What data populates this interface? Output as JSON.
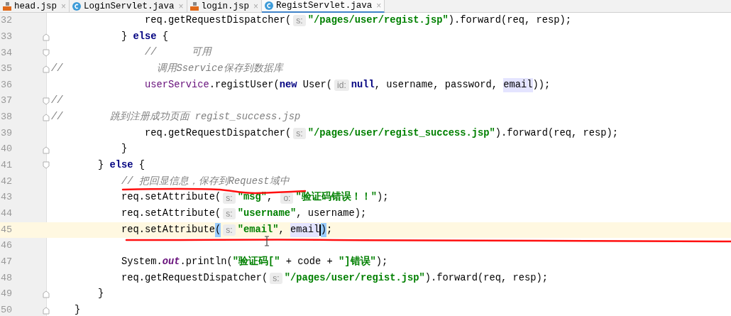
{
  "tabs": [
    {
      "label": "head.jsp",
      "kind": "jsp",
      "close": "×",
      "selected": false
    },
    {
      "label": "LoginServlet.java",
      "kind": "class",
      "close": "×",
      "selected": false
    },
    {
      "label": "login.jsp",
      "kind": "jsp",
      "close": "×",
      "selected": false
    },
    {
      "label": "RegistServlet.java",
      "kind": "class",
      "close": "×",
      "selected": true
    }
  ],
  "editor": {
    "lines": [
      {
        "number": "32",
        "current": false,
        "kind": "plain",
        "tokens": [
          {
            "kind": "plain",
            "text": "                req.getRequestDispatcher("
          },
          {
            "kind": "hint",
            "text": "s:"
          },
          {
            "kind": "string",
            "text": "\"/pages/user/regist.jsp\""
          },
          {
            "kind": "plain",
            "text": ").forward(req, resp);"
          }
        ]
      },
      {
        "number": "33",
        "current": false,
        "kind": "fold-end",
        "tokens": [
          {
            "kind": "plain",
            "text": "            } "
          },
          {
            "kind": "keyword",
            "text": "else"
          },
          {
            "kind": "plain",
            "text": " {"
          }
        ]
      },
      {
        "number": "34",
        "current": false,
        "kind": "fold-start",
        "tokens": [
          {
            "kind": "comment",
            "text": "                //      可用"
          }
        ]
      },
      {
        "number": "35",
        "current": false,
        "kind": "fold-end",
        "tokens": [
          {
            "kind": "comment",
            "text": "//                调用Sservice保存到数据库"
          }
        ]
      },
      {
        "number": "36",
        "current": false,
        "kind": "plain",
        "tokens": [
          {
            "kind": "field",
            "text": "                userService"
          },
          {
            "kind": "plain",
            "text": ".registUser("
          },
          {
            "kind": "keyword",
            "text": "new"
          },
          {
            "kind": "plain",
            "text": " User("
          },
          {
            "kind": "hint",
            "text": "id:"
          },
          {
            "kind": "keyword",
            "text": "null"
          },
          {
            "kind": "plain",
            "text": ", username, password, "
          },
          {
            "kind": "ref",
            "text": "email"
          },
          {
            "kind": "plain",
            "text": "));"
          }
        ]
      },
      {
        "number": "37",
        "current": false,
        "kind": "fold-start",
        "tokens": [
          {
            "kind": "comment",
            "text": "//"
          }
        ]
      },
      {
        "number": "38",
        "current": false,
        "kind": "fold-end",
        "tokens": [
          {
            "kind": "comment",
            "text": "//        跳到注册成功页面 regist_success.jsp"
          }
        ]
      },
      {
        "number": "39",
        "current": false,
        "kind": "plain",
        "tokens": [
          {
            "kind": "plain",
            "text": "                req.getRequestDispatcher("
          },
          {
            "kind": "hint",
            "text": "s:"
          },
          {
            "kind": "string",
            "text": "\"/pages/user/regist_success.jsp\""
          },
          {
            "kind": "plain",
            "text": ").forward(req, resp);"
          }
        ]
      },
      {
        "number": "40",
        "current": false,
        "kind": "fold-end",
        "tokens": [
          {
            "kind": "plain",
            "text": "            }"
          }
        ]
      },
      {
        "number": "41",
        "current": false,
        "kind": "fold-start",
        "tokens": [
          {
            "kind": "plain",
            "text": "        } "
          },
          {
            "kind": "keyword",
            "text": "else"
          },
          {
            "kind": "plain",
            "text": " {"
          }
        ]
      },
      {
        "number": "42",
        "current": false,
        "kind": "plain",
        "tokens": [
          {
            "kind": "comment",
            "text": "            // 把回显信息，保存到Request域中"
          }
        ]
      },
      {
        "number": "43",
        "current": false,
        "kind": "plain",
        "tokens": [
          {
            "kind": "plain",
            "text": "            req.setAttribute("
          },
          {
            "kind": "hint",
            "text": "s:"
          },
          {
            "kind": "string",
            "text": "\"msg\""
          },
          {
            "kind": "plain",
            "text": ", "
          },
          {
            "kind": "hint",
            "text": "o:"
          },
          {
            "kind": "string",
            "text": "\"验证码错误！！\""
          },
          {
            "kind": "plain",
            "text": ");"
          }
        ]
      },
      {
        "number": "44",
        "current": false,
        "kind": "plain",
        "tokens": [
          {
            "kind": "plain",
            "text": "            req.setAttribute("
          },
          {
            "kind": "hint",
            "text": "s:"
          },
          {
            "kind": "string",
            "text": "\"username\""
          },
          {
            "kind": "plain",
            "text": ", username);"
          }
        ]
      },
      {
        "number": "45",
        "current": true,
        "kind": "plain",
        "tokens": [
          {
            "kind": "plain",
            "text": "            req.setAttribute"
          },
          {
            "kind": "brace",
            "text": "("
          },
          {
            "kind": "hint",
            "text": "s:"
          },
          {
            "kind": "string",
            "text": "\"email\""
          },
          {
            "kind": "plain",
            "text": ", "
          },
          {
            "kind": "ref",
            "text": "email"
          },
          {
            "kind": "caret"
          },
          {
            "kind": "brace",
            "text": ")"
          },
          {
            "kind": "plain",
            "text": ";"
          }
        ]
      },
      {
        "number": "46",
        "current": false,
        "kind": "plain"
      },
      {
        "number": "47",
        "current": false,
        "kind": "plain",
        "tokens": [
          {
            "kind": "plain",
            "text": "            System."
          },
          {
            "kind": "static",
            "text": "out"
          },
          {
            "kind": "plain",
            "text": ".println("
          },
          {
            "kind": "string",
            "text": "\"验证码[\""
          },
          {
            "kind": "plain",
            "text": " + code + "
          },
          {
            "kind": "string",
            "text": "\"]错误\""
          },
          {
            "kind": "plain",
            "text": ");"
          }
        ]
      },
      {
        "number": "48",
        "current": false,
        "kind": "plain",
        "tokens": [
          {
            "kind": "plain",
            "text": "            req.getRequestDispatcher("
          },
          {
            "kind": "hint",
            "text": "s:"
          },
          {
            "kind": "string",
            "text": "\"/pages/user/regist.jsp\""
          },
          {
            "kind": "plain",
            "text": ").forward(req, resp);"
          }
        ]
      },
      {
        "number": "49",
        "current": false,
        "kind": "fold-end",
        "tokens": [
          {
            "kind": "plain",
            "text": "        }"
          }
        ]
      },
      {
        "number": "50",
        "current": false,
        "kind": "fold-end",
        "tokens": [
          {
            "kind": "plain",
            "text": "    }"
          }
        ]
      }
    ]
  }
}
